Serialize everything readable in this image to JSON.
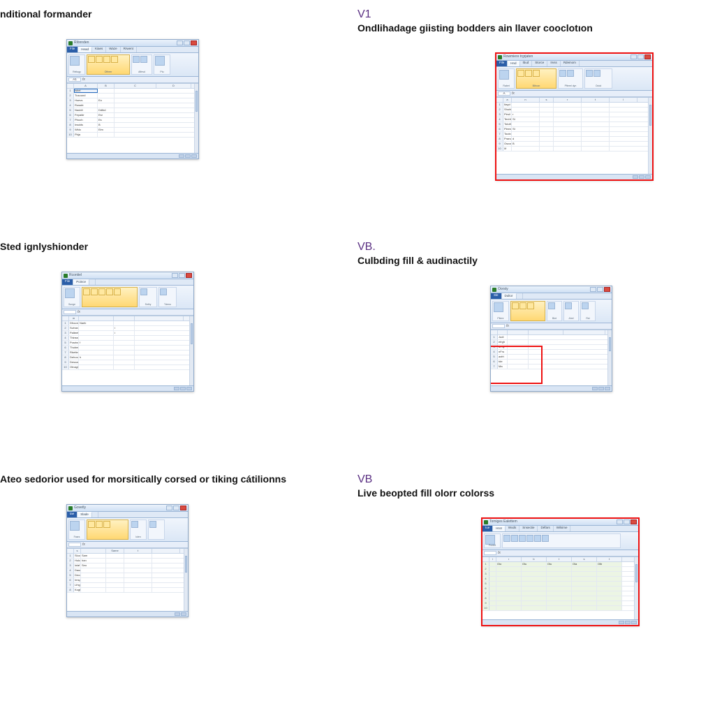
{
  "cells": [
    {
      "tag": "",
      "title": "nditional formander"
    },
    {
      "tag": "V1",
      "title": "Ondlihadage giisting bodders ain llaver cooclotıon"
    },
    {
      "tag": "",
      "title": "Sted ignlyshionder"
    },
    {
      "tag": "VB.",
      "title": "Culbding fill & audinactily"
    },
    {
      "tag": "",
      "title": "Ateo sedorior used for morsitically corsed or tiking cátilionns"
    },
    {
      "tag": "VB",
      "title": "Live beopted fill olorr colorss"
    }
  ],
  "window_titles": [
    "Rlönnden",
    "Rowmiere trgrjaten",
    "Rcontiel",
    "Oorsty",
    "Govetly",
    "Tomiges Ealettem"
  ],
  "tabs": [
    "File",
    "Head",
    "Kiaes",
    "Waze",
    "Rrwent"
  ],
  "tabs_alt": [
    "File",
    "Hnd",
    "Ibud",
    "Storce",
    "Irvss",
    "Rdeinom"
  ],
  "ribbon_groups": [
    "Reltogy",
    "Offreer",
    "Affesd",
    "Ptu"
  ],
  "cell_ref": "A1",
  "col_letters": [
    "A",
    "B",
    "C",
    "D",
    "E",
    "F"
  ],
  "dataA": [
    [
      "Isbel",
      ""
    ],
    [
      "Tusound",
      ""
    ],
    [
      "Hoevs",
      "Eo"
    ],
    [
      "Rossbt",
      ""
    ],
    [
      "Nauldt",
      "Ddtkd"
    ],
    [
      "Fepaldr",
      "Esr"
    ],
    [
      "Pbuoh",
      "Es"
    ],
    [
      "Insdds",
      "B"
    ],
    [
      "Wklo",
      "Eim"
    ],
    [
      "Pbja",
      ""
    ]
  ],
  "dataB": [
    [
      "Itayd",
      "",
      "",
      "",
      ""
    ],
    [
      "Shuhten",
      "",
      "",
      "",
      ""
    ],
    [
      "Pirsil",
      "r",
      "",
      "",
      ""
    ],
    [
      "Tenhfornt",
      "St",
      "",
      "",
      ""
    ],
    [
      "Totoftealr",
      "",
      "",
      "",
      ""
    ],
    [
      "PleenHersls",
      "St",
      "",
      "",
      ""
    ],
    [
      "Toutndes",
      "",
      "",
      "",
      ""
    ],
    [
      "Prancfose",
      "d",
      "",
      "",
      ""
    ],
    [
      "Oscondit",
      "B",
      "",
      "",
      ""
    ],
    [
      "Iif",
      "",
      "",
      "",
      ""
    ]
  ],
  "dataC": [
    [
      "Dfcuosst",
      "Naek",
      ""
    ],
    [
      "Svimedl",
      "",
      "i"
    ],
    [
      "Palteetl",
      "",
      "i"
    ],
    [
      "Thinssv",
      "",
      ""
    ],
    [
      "PosrinnCeka",
      "f",
      ""
    ],
    [
      "Thobent",
      "",
      ""
    ],
    [
      "Rbettes",
      "",
      ""
    ],
    [
      "Dehooct",
      "h",
      ""
    ],
    [
      "Desoagl",
      "",
      ""
    ],
    [
      "Otnagl",
      "",
      ""
    ]
  ],
  "dataD": [
    [
      "Judi",
      ""
    ],
    [
      "efrgh",
      ""
    ],
    [
      "sFby",
      ""
    ],
    [
      "nFru",
      ""
    ],
    [
      "axfrt",
      ""
    ],
    [
      "tde",
      ""
    ],
    [
      "Ma",
      ""
    ]
  ],
  "dataE": [
    [
      "Sluod",
      "Sam",
      "",
      ""
    ],
    [
      "Hukone",
      "han",
      "",
      ""
    ],
    [
      "lolaf",
      "Seo",
      "",
      ""
    ],
    [
      "Daunio",
      "",
      "",
      ""
    ],
    [
      "Deconl",
      "",
      "",
      ""
    ],
    [
      "Imspdl",
      "",
      "",
      ""
    ],
    [
      "Lfngat",
      "",
      "",
      ""
    ],
    [
      "Kogtl",
      "",
      "",
      ""
    ]
  ],
  "dataF_cols": [
    "Oio",
    "Olu",
    "Oiu",
    "Ola",
    "Olb"
  ]
}
